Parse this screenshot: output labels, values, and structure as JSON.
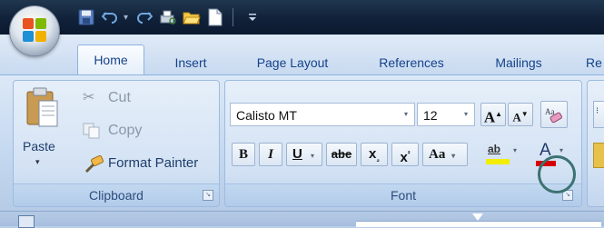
{
  "ribbon_tabs": [
    "Home",
    "Insert",
    "Page Layout",
    "References",
    "Mailings",
    "Re"
  ],
  "clipboard": {
    "paste": "Paste",
    "cut": "Cut",
    "copy": "Copy",
    "format_painter": "Format Painter",
    "group_label": "Clipboard"
  },
  "font": {
    "family": "Calisto MT",
    "size": "12",
    "grow": "A",
    "shrink": "A",
    "bold": "B",
    "italic": "I",
    "underline": "U",
    "strike": "abe",
    "subscript": "x",
    "superscript": "x",
    "change_case": "Aa",
    "highlight": "ab",
    "font_color": "A",
    "group_label": "Font"
  },
  "icons": [
    "office-logo-icon",
    "save-icon",
    "undo-icon",
    "redo-icon",
    "print-preview-icon",
    "open-folder-icon",
    "new-document-icon",
    "customize-qat-icon",
    "paste-icon",
    "scissors-icon",
    "copy-icon",
    "paintbrush-icon",
    "clear-formatting-icon",
    "dialog-launcher-icon"
  ],
  "colors": {
    "highlight": "#f2ee00",
    "font_color": "#d80000",
    "accent": "#15428b",
    "annotation_circle": "#3c7272"
  }
}
